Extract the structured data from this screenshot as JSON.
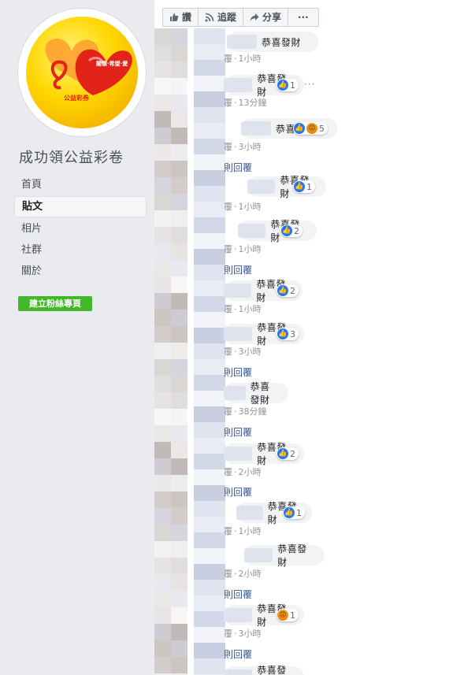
{
  "sidebar": {
    "page_name": "成功領公益彩卷",
    "logo_text_top": "關懷·希望·愛",
    "logo_text_bottom": "公益彩券",
    "nav": [
      "首頁",
      "貼文",
      "相片",
      "社群",
      "關於"
    ],
    "active_nav": "貼文",
    "create_page": "建立粉絲專頁"
  },
  "actions": {
    "like": "讚",
    "follow": "追蹤",
    "share": "分享",
    "more": "···"
  },
  "comments": [
    {
      "text": "恭喜發財",
      "time": "1小時",
      "reactions": "",
      "reply": ""
    },
    {
      "text": "恭喜發財",
      "time": "13分鐘",
      "reactions": "1",
      "reply": ""
    },
    {
      "text": "恭喜發財",
      "time": "3小時",
      "reactions": "5",
      "reply": "則回覆"
    },
    {
      "text": "恭喜發財",
      "time": "1小時",
      "reactions": "1",
      "reply": ""
    },
    {
      "text": "恭喜發財",
      "time": "1小時",
      "reactions": "2",
      "reply": "則回覆"
    },
    {
      "text": "恭喜發財",
      "time": "1小時",
      "reactions": "2",
      "reply": ""
    },
    {
      "text": "恭喜發財",
      "time": "3小時",
      "reactions": "3",
      "reply": "則回覆"
    },
    {
      "text": "恭喜發財",
      "time": "38分鐘",
      "reactions": "",
      "reply": "則回覆"
    },
    {
      "text": "恭喜發財",
      "time": "2小時",
      "reactions": "2",
      "reply": "則回覆"
    },
    {
      "text": "恭喜發財",
      "time": "1小時",
      "reactions": "1",
      "reply": ""
    },
    {
      "text": "恭喜發財",
      "time": "2小時",
      "reactions": "",
      "reply": "則回覆"
    },
    {
      "text": "恭喜發財",
      "time": "3小時",
      "reactions": "1",
      "reply": "則回覆"
    },
    {
      "text": "恭喜發財",
      "time": "",
      "reactions": "",
      "reply": ""
    }
  ],
  "meta_prefix": "覆",
  "colors": {
    "like_blue": "#2078f4",
    "link": "#385898",
    "green": "#42b72a"
  }
}
